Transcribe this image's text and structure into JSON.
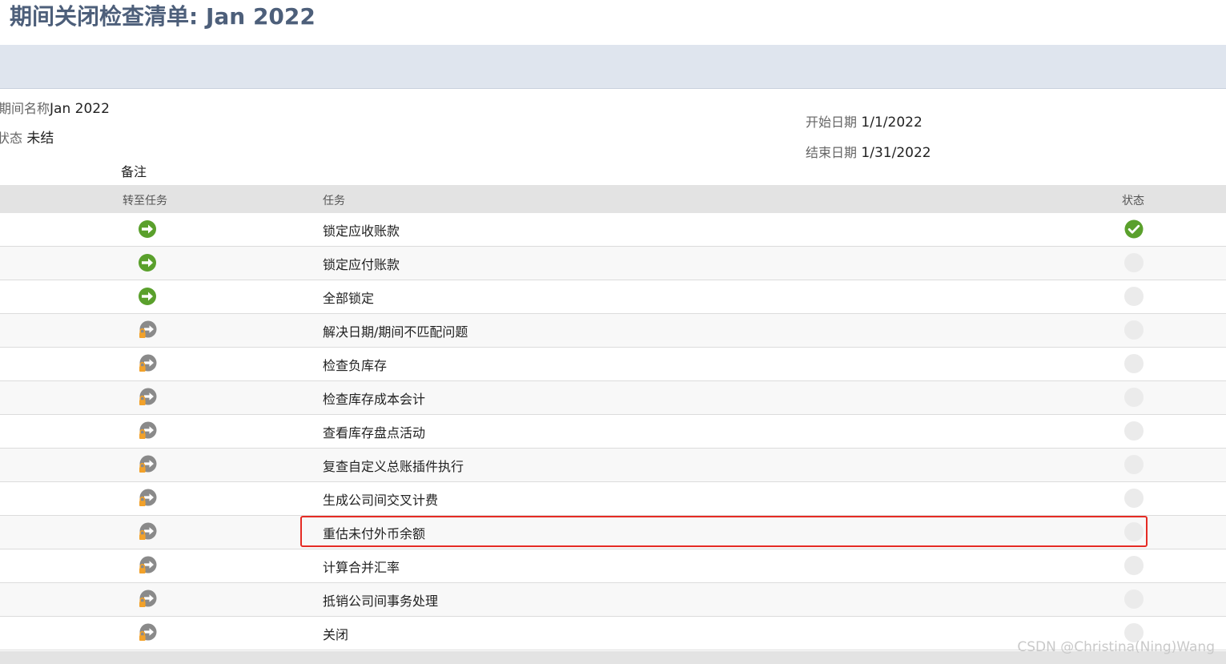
{
  "header": {
    "title": "期间关闭检查清单: Jan 2022"
  },
  "info": {
    "name_label": "期间名称",
    "name_value": "Jan 2022",
    "status_label": "状态",
    "status_value": "未结",
    "start_label": "开始日期",
    "start_value": "1/1/2022",
    "end_label": "结束日期",
    "end_value": "1/31/2022",
    "notes_label": "备注"
  },
  "table": {
    "col_goto": "转至任务",
    "col_task": "任务",
    "col_status": "状态",
    "rows": [
      {
        "task": "锁定应收账款",
        "goto_icon": "green-arrow-icon",
        "status": "complete"
      },
      {
        "task": "锁定应付账款",
        "goto_icon": "green-arrow-icon",
        "status": "empty"
      },
      {
        "task": "全部锁定",
        "goto_icon": "green-arrow-icon",
        "status": "empty"
      },
      {
        "task": "解决日期/期间不匹配问题",
        "goto_icon": "locked-arrow-icon",
        "status": "empty"
      },
      {
        "task": "检查负库存",
        "goto_icon": "locked-arrow-icon",
        "status": "empty"
      },
      {
        "task": "检查库存成本会计",
        "goto_icon": "locked-arrow-icon",
        "status": "empty"
      },
      {
        "task": "查看库存盘点活动",
        "goto_icon": "locked-arrow-icon",
        "status": "empty"
      },
      {
        "task": "复查自定义总账插件执行",
        "goto_icon": "locked-arrow-icon",
        "status": "empty"
      },
      {
        "task": "生成公司间交叉计费",
        "goto_icon": "locked-arrow-icon",
        "status": "empty"
      },
      {
        "task": "重估未付外币余额",
        "goto_icon": "locked-arrow-icon",
        "status": "empty"
      },
      {
        "task": "计算合并汇率",
        "goto_icon": "locked-arrow-icon",
        "status": "empty"
      },
      {
        "task": "抵销公司间事务处理",
        "goto_icon": "locked-arrow-icon",
        "status": "empty"
      },
      {
        "task": "关闭",
        "goto_icon": "locked-arrow-icon",
        "status": "empty"
      }
    ]
  },
  "colors": {
    "green": "#5aa02c",
    "locked_gray": "#8a8a8a",
    "lock_orange": "#f2a12a",
    "highlight_red": "#e52b24"
  },
  "watermark": "CSDN @Christina(Ning)Wang"
}
